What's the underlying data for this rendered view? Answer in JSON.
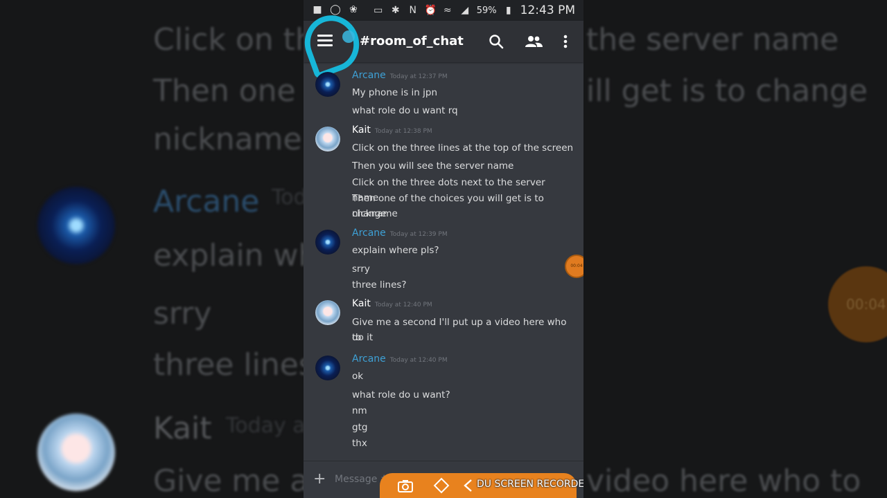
{
  "status_bar": {
    "battery": "59%",
    "time": "12:43 PM"
  },
  "header": {
    "channel": "#room_of_chat"
  },
  "messages": [
    {
      "author": "Arcane",
      "timestamp": "Today at 12:37 PM",
      "lines": [
        "My phone is in jpn",
        "what role do u want rq"
      ]
    },
    {
      "author": "Kait",
      "timestamp": "Today at 12:38 PM",
      "lines": [
        "Click on the three lines at the top of the screen",
        "Then you will see the server name",
        "Click on the three dots next to the server name",
        "Then one of the choices you will get is to change",
        "nickname"
      ]
    },
    {
      "author": "Arcane",
      "timestamp": "Today at 12:39 PM",
      "lines": [
        "explain where pls?",
        "srry",
        "three lines?"
      ]
    },
    {
      "author": "Kait",
      "timestamp": "Today at 12:40 PM",
      "lines": [
        "Give me a second I'll put up a video here who to",
        "do it"
      ]
    },
    {
      "author": "Arcane",
      "timestamp": "Today at 12:40 PM",
      "lines": [
        "ok",
        "what role do u want?",
        "nm",
        "gtg",
        "thx"
      ]
    }
  ],
  "input": {
    "placeholder": "Message #room_of_chat"
  },
  "recorder": {
    "label": "DU SCREEN RECORDER",
    "timer": "00:04"
  },
  "background_echo": {
    "lines": [
      "Click on th",
      "the server name",
      "Then one o",
      "ill get is to change",
      "nickname",
      "Arcane",
      "Tod",
      "explain wh",
      "srry",
      "three lines",
      "Kait",
      "Today a",
      "Give me a s",
      "video here who to"
    ]
  }
}
